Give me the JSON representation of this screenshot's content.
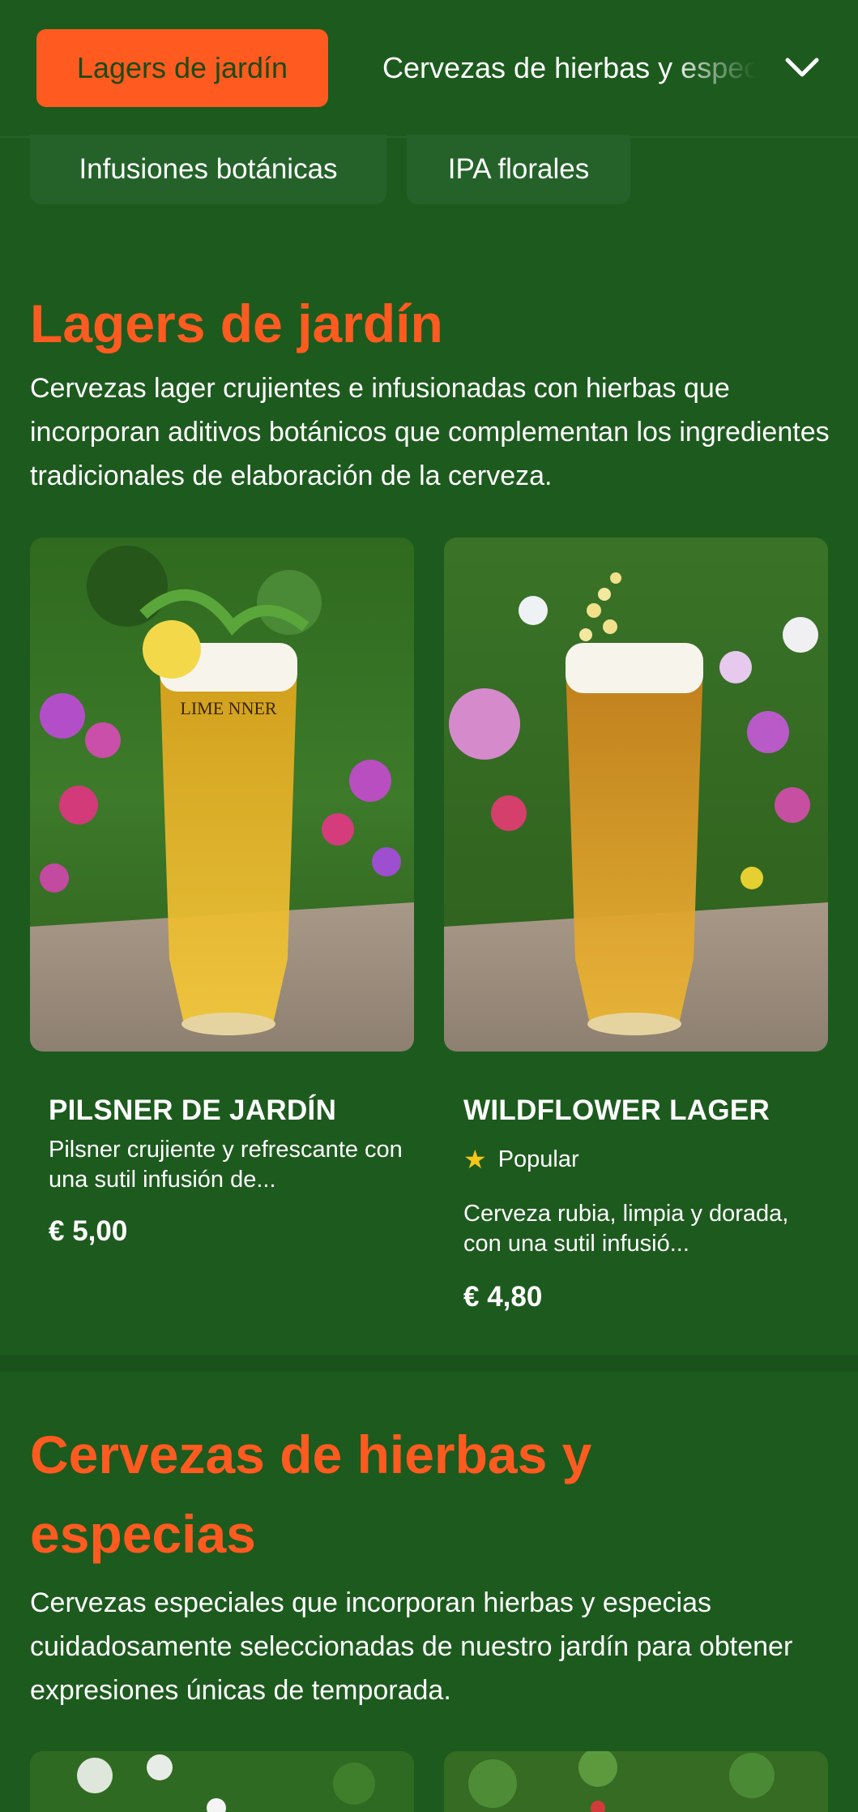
{
  "nav": {
    "active_tab": "Lagers de jardín",
    "next_tab": "Cervezas de hierbas y especias",
    "chips": [
      "Infusiones botánicas",
      "IPA florales"
    ]
  },
  "sections": [
    {
      "title": "Lagers de jardín",
      "description": "Cervezas lager crujientes e infusionadas con hierbas que incorporan aditivos botánicos que complementan los ingredientes tradicionales de elaboración de la cerveza.",
      "products": [
        {
          "name": "PILSNER DE JARDÍN",
          "description": "Pilsner crujiente y refrescante con una sutil infusión de...",
          "price": "€ 5,00",
          "glass_text": "LIME NNER"
        },
        {
          "name": "WILDFLOWER LAGER",
          "badge": "Popular",
          "description": "Cerveza rubia, limpia y dorada, con una sutil infusió...",
          "price": "€ 4,80"
        }
      ]
    },
    {
      "title": "Cervezas de hierbas y especias",
      "description": "Cervezas especiales que incorporan hierbas y especias cuidadosamente seleccionadas de nuestro jardín para obtener expresiones únicas de temporada."
    }
  ],
  "colors": {
    "background": "#1d5a1e",
    "accent": "#ff5a1f",
    "chip": "#24622a",
    "star": "#f5c518"
  },
  "icons": {
    "chevron": "chevron-down-icon",
    "star": "star-icon"
  }
}
